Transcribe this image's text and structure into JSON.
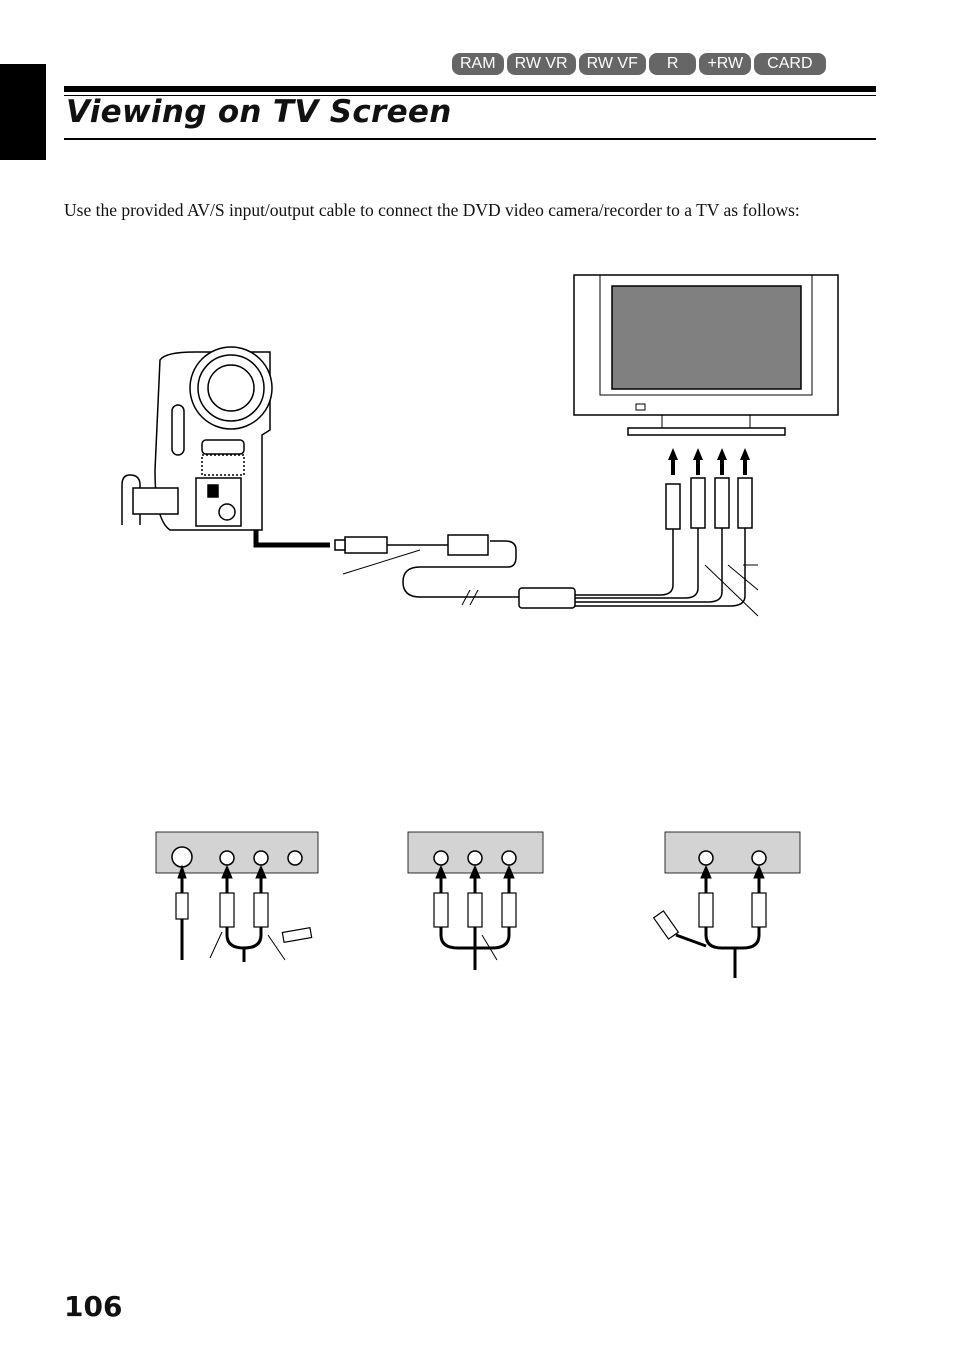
{
  "header": {
    "badges": [
      "RAM",
      "RW VR",
      "RW VF",
      "R",
      "+RW",
      "CARD"
    ],
    "title": "Viewing on TV Screen"
  },
  "body": {
    "intro": "Use the provided AV/S  input/output cable to connect the DVD video camera/recorder to a TV as follows:"
  },
  "diagram": {
    "icons": [
      "camcorder",
      "tv",
      "av-s-cable",
      "s-video-plug",
      "rca-plug",
      "arrow-up"
    ],
    "colors": {
      "screen": "#808080",
      "panel": "#d3d3d3",
      "line": "#000000"
    }
  },
  "footer": {
    "page_number": "106"
  }
}
